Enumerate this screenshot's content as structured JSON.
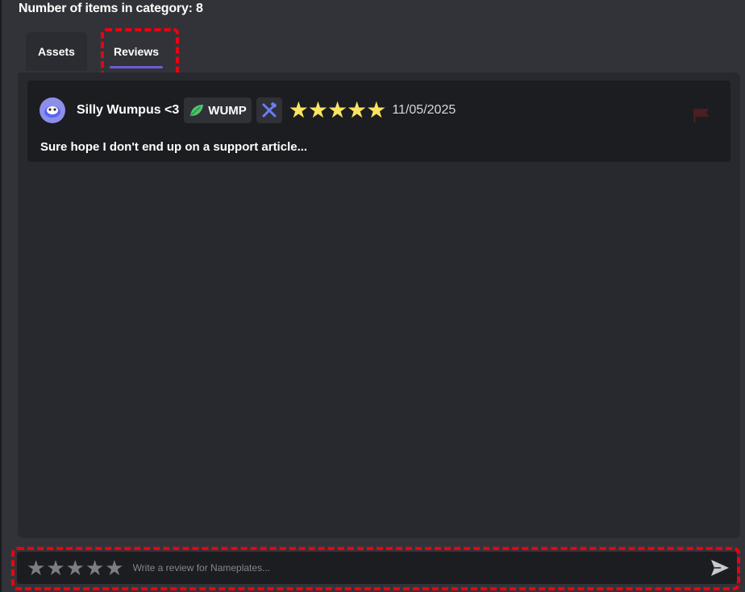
{
  "header": {
    "title": "Number of items in category: 8"
  },
  "tabs": [
    {
      "label": "Assets",
      "selected": false
    },
    {
      "label": "Reviews",
      "selected": true
    }
  ],
  "review": {
    "author": "Silly Wumpus <3",
    "badge_label": "WUMP",
    "badge_icon": "leaf-icon",
    "role_icon": "hammer-wrench-icon",
    "rating": 5,
    "rating_max": 5,
    "date": "11/05/2025",
    "body": "Sure hope I don't end up on a support article...",
    "flag_icon": "flag-icon"
  },
  "composer": {
    "placeholder": "Write a review for Nameplates...",
    "value": "",
    "rating_selected": 0,
    "send_icon": "send-icon"
  },
  "colors": {
    "background": "#323339",
    "panel": "#28292e",
    "card": "#1c1d21",
    "star_filled": "#f9e463",
    "star_empty": "#7d7e84",
    "tab_underline": "#6a5fd6",
    "highlight": "#ee0010"
  }
}
